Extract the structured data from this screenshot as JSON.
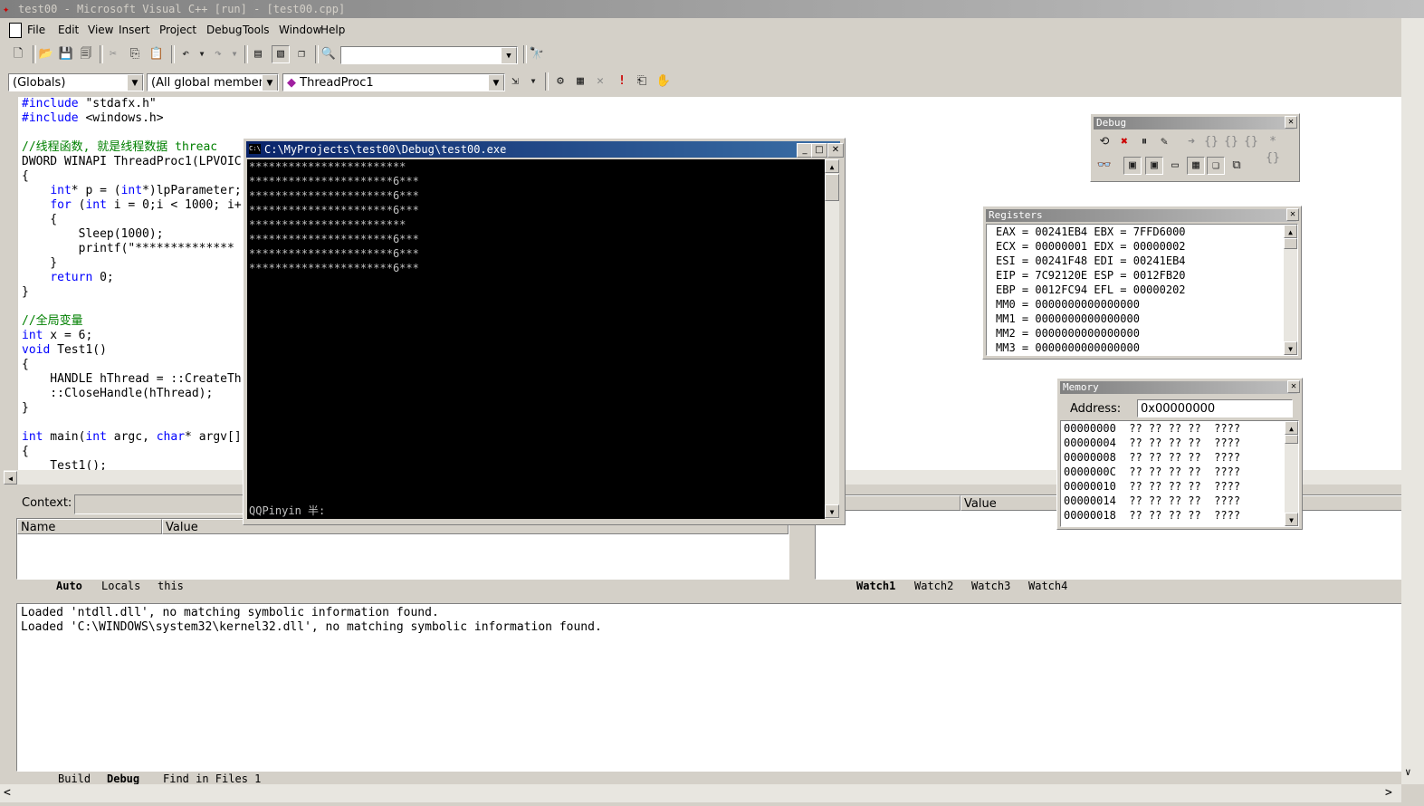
{
  "window": {
    "title": "test00 - Microsoft Visual C++ [run] - [test00.cpp]"
  },
  "menu": [
    "File",
    "Edit",
    "View",
    "Insert",
    "Project",
    "Debug",
    "Tools",
    "Window",
    "Help"
  ],
  "toolbar2": {
    "globals": "(Globals)",
    "members": "(All global members",
    "function": "ThreadProc1"
  },
  "editor": {
    "lines": [
      "#include \"stdafx.h\"",
      "#include <windows.h>",
      "",
      "//线程函数, 就是线程数据 threac",
      "DWORD WINAPI ThreadProc1(LPVOIC",
      "{",
      "    int* p = (int*)lpParameter;",
      "    for (int i = 0;i < 1000; i+",
      "    {",
      "        Sleep(1000);",
      "        printf(\"**************",
      "    }",
      "    return 0;",
      "}",
      "",
      "//全局变量",
      "int x = 6;",
      "void Test1()",
      "{",
      "    HANDLE hThread = ::CreateTh",
      "    ::CloseHandle(hThread);",
      "}",
      "",
      "int main(int argc, char* argv[]",
      "{",
      "    Test1();"
    ]
  },
  "console": {
    "title": "C:\\MyProjects\\test00\\Debug\\test00.exe",
    "lines": [
      "************************",
      "**********************6***",
      "**********************6***",
      "**********************6***",
      "************************",
      "**********************6***",
      "**********************6***",
      "**********************6***"
    ],
    "ime": "QQPinyin 半:"
  },
  "debug_toolbar": {
    "title": "Debug"
  },
  "registers": {
    "title": "Registers",
    "lines": [
      "EAX = 00241EB4 EBX = 7FFD6000",
      "ECX = 00000001 EDX = 00000002",
      "ESI = 00241F48 EDI = 00241EB4",
      "EIP = 7C92120E ESP = 0012FB20",
      "EBP = 0012FC94 EFL = 00000202",
      "MM0 = 0000000000000000",
      "MM1 = 0000000000000000",
      "MM2 = 0000000000000000",
      "MM3 = 0000000000000000"
    ]
  },
  "memory": {
    "title": "Memory",
    "address_label": "Address:",
    "address_value": "0x00000000",
    "lines": [
      "00000000  ?? ?? ?? ??  ????",
      "00000004  ?? ?? ?? ??  ????",
      "00000008  ?? ?? ?? ??  ????",
      "0000000C  ?? ?? ?? ??  ????",
      "00000010  ?? ?? ?? ??  ????",
      "00000014  ?? ?? ?? ??  ????",
      "00000018  ?? ?? ?? ??  ????"
    ]
  },
  "variables": {
    "context_label": "Context:",
    "col_name": "Name",
    "col_value": "Value",
    "tabs": [
      "Auto",
      "Locals",
      "this"
    ]
  },
  "watch": {
    "col_name": "e",
    "col_value": "Value",
    "tabs": [
      "Watch1",
      "Watch2",
      "Watch3",
      "Watch4"
    ]
  },
  "output": {
    "lines": [
      "Loaded 'ntdll.dll', no matching symbolic information found.",
      "Loaded 'C:\\WINDOWS\\system32\\kernel32.dll', no matching symbolic information found."
    ],
    "tabs": [
      "Build",
      "Debug",
      "Find in Files 1"
    ]
  }
}
